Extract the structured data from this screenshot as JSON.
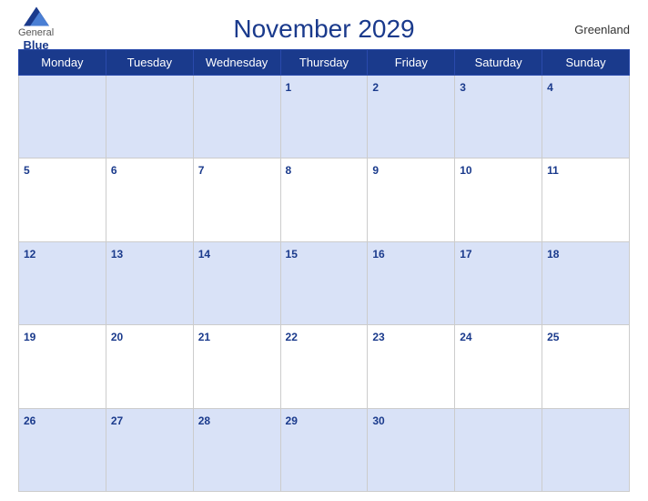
{
  "header": {
    "title": "November 2029",
    "region": "Greenland",
    "logo": {
      "general": "General",
      "blue": "Blue"
    }
  },
  "weekdays": [
    "Monday",
    "Tuesday",
    "Wednesday",
    "Thursday",
    "Friday",
    "Saturday",
    "Sunday"
  ],
  "weeks": [
    [
      null,
      null,
      null,
      1,
      2,
      3,
      4
    ],
    [
      5,
      6,
      7,
      8,
      9,
      10,
      11
    ],
    [
      12,
      13,
      14,
      15,
      16,
      17,
      18
    ],
    [
      19,
      20,
      21,
      22,
      23,
      24,
      25
    ],
    [
      26,
      27,
      28,
      29,
      30,
      null,
      null
    ]
  ]
}
